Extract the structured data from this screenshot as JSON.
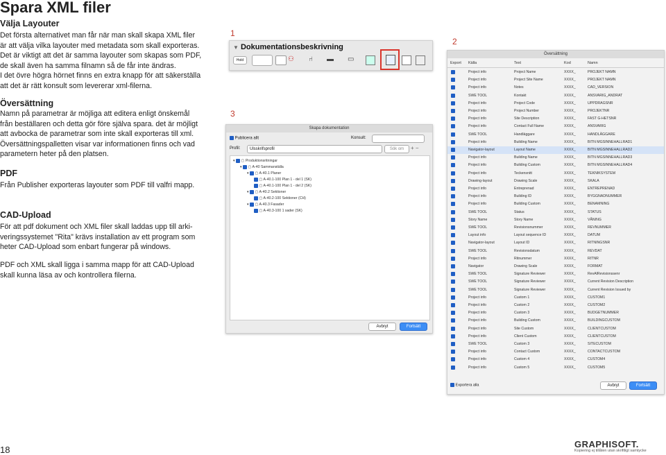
{
  "page_title": "Spara XML filer",
  "left": {
    "sec1_heading": "Välja Layouter",
    "sec1_lines": [
      "Det första alternativet man får när man skall skapa XML filer",
      "är att välja vilka layouter med metadata som skall exporteras.",
      "Det är viktigt att det är samma layouter som skapas som PDF,",
      "de skall även ha samma filnamn så de får inte ändras.",
      "I det övre högra hörnet finns en extra knapp för att säkerställa",
      "att det är rätt konsult som levererar xml-filerna."
    ],
    "sec2_heading": "Översättning",
    "sec2_lines": [
      "Namn på parametrar är möjliga att editera enligt önskemål",
      "från beställaren och detta gör före själva spara. det är möjligt",
      "att avbocka de parametrar som inte skall exporteras till xml.",
      "Översättningspalletten visar var informationen finns och vad",
      "parametern heter på den platsen."
    ],
    "sec3_heading": "PDF",
    "sec3_lines": [
      "Från Publisher exporteras layouter som PDF till valfri mapp."
    ],
    "sec4_heading": "CAD-Upload",
    "sec4_lines": [
      "För att pdf dokument och XML filer skall laddas upp till arki-",
      "veringssystemet \"Rita\" krävs installation av ett program som",
      "heter CAD-Upload som enbart fungerar på windows."
    ],
    "sec5_lines": [
      "PDF och XML skall ligga i samma mapp för att CAD-Upload",
      "skall kunna läsa av och kontrollera filerna."
    ]
  },
  "markers": {
    "one": "1",
    "two": "2",
    "three": "3"
  },
  "shot1": {
    "title": "Dokumentationsbeskrivning",
    "field_label": "Hold"
  },
  "shot3": {
    "title": "Skapa dokumentation",
    "publish_all": "Publicera allt",
    "konsult_label": "Konsult:",
    "profil_label": "Profil:",
    "profil_value": "Ulsskrifsprofil",
    "search_placeholder": "Sök om",
    "tree": [
      "Produktionsritningar",
      "A-40 Sammanställa",
      "A-40.1 Planer",
      "A-40.1-100 Plan 1 - del 1 (SK)",
      "A-40.1-100 Plan 1 - del 2 (SK)",
      "A-40.2 Sektioner",
      "A-40.2-100 Sektioner (CH)",
      "A-40.3 Fasader",
      "A-40.3-100 1 sader (SK)"
    ],
    "cancel": "Avbryt",
    "continue": "Fortsätt"
  },
  "shot2": {
    "title": "Översättning",
    "col_export": "Export",
    "col_kalla": "Källa",
    "col_text": "Text",
    "col_kod": "Kod",
    "col_namn": "Namn",
    "rows": [
      [
        "Project info",
        "Project Name",
        "XXXX_",
        "PROJEKT NAMN"
      ],
      [
        "Project info",
        "Project Site Name",
        "XXXX_",
        "PROJEKT NAMN"
      ],
      [
        "Project info",
        "Notes",
        "XXXX_",
        "CAD_VERSION"
      ],
      [
        "SWE TOOL",
        "Kontakt",
        "XXXX_",
        "ANSVARIG_ANDRAT"
      ],
      [
        "Project info",
        "Project Code",
        "XXXX_",
        "UPPDRAGSNR"
      ],
      [
        "Project info",
        "Project Number",
        "XXXX_",
        "PROJEKTNR"
      ],
      [
        "Project info",
        "Site Description",
        "XXXX_",
        "FAST G-HETSNR"
      ],
      [
        "Project info",
        "Contact Full Name",
        "XXXX_",
        "ANSVARIG"
      ],
      [
        "SWE TOOL",
        "Handläggare",
        "XXXX_",
        "HANDLÄGGARE"
      ],
      [
        "Project info",
        "Building Name",
        "XXXX_",
        "BITN MGSINNEHALLRAD1"
      ],
      [
        "Navigator-layout",
        "Layout Name",
        "XXXX_",
        "BITN MGSINNEHALLRAD2"
      ],
      [
        "Project info",
        "Building Name",
        "XXXX_",
        "BITN MGSINNEHALLRAD3"
      ],
      [
        "Project info",
        "Building Custom",
        "XXXX_",
        "BITN MGSINNEHALLRAD4"
      ],
      [
        "Project info",
        "Teckensnitt",
        "XXXX_",
        "TEKNIKSYSTEM"
      ],
      [
        "Drawing-layout",
        "Drawing Scale",
        "XXXX_",
        "SKALA"
      ],
      [
        "Project info",
        "Entreprenad",
        "XXXX_",
        "ENTREPRENAD"
      ],
      [
        "Project info",
        "Building ID",
        "XXXX_",
        "BYGGNADNUMMER"
      ],
      [
        "Project info",
        "Building Custom",
        "XXXX_",
        "BENAMNING"
      ],
      [
        "SWE TOOL",
        "Status",
        "XXXX_",
        "STATUS"
      ],
      [
        "Story Name",
        "Story Name",
        "XXXX_",
        "VÅNING"
      ],
      [
        "SWE TOOL",
        "Revisionsnummer",
        "XXXX_",
        "REVNUMMER"
      ],
      [
        "Layout info",
        "Layout sequence ID",
        "XXXX_",
        "DATUM"
      ],
      [
        "Navigator-layout",
        "Layout ID",
        "XXXX_",
        "RITNINGSNR"
      ],
      [
        "SWE TOOL",
        "Revisionsdatum",
        "XXXX_",
        "REVDAT"
      ],
      [
        "Project info",
        "Ritnummer",
        "XXXX_",
        "RITNR"
      ],
      [
        "Navigator",
        "Drawing Scale",
        "XXXX_",
        "FORMAT"
      ],
      [
        "SWE TOOL",
        "Signature Reviewer",
        "XXXX_",
        "RevAlRevisionssenr"
      ],
      [
        "SWE TOOL",
        "Signature Reviewer",
        "XXXX_",
        "Current Revision Description"
      ],
      [
        "SWE TOOL",
        "Signature Reviewer",
        "XXXX_",
        "Current Revision Issued by"
      ],
      [
        "Project info",
        "Custom 1",
        "XXXX_",
        "CUSTOM1"
      ],
      [
        "Project info",
        "Custom 2",
        "XXXX_",
        "CUSTOM2"
      ],
      [
        "Project info",
        "Custom 3",
        "XXXX_",
        "BUDGETNUMMER"
      ],
      [
        "Project info",
        "Building Custom",
        "XXXX_",
        "BUILDINGCUSTOM"
      ],
      [
        "Project info",
        "Site Custom",
        "XXXX_",
        "CLIENTCUSTOM"
      ],
      [
        "Project info",
        "Client Custom",
        "XXXX_",
        "CLIENTCUSTOM"
      ],
      [
        "SWE TOOL",
        "Custom 3",
        "XXXX_",
        "SITECUSTOM"
      ],
      [
        "Project info",
        "Contact Custom",
        "XXXX_",
        "CONTACTCUSTOM"
      ],
      [
        "Project info",
        "Custom 4",
        "XXXX_",
        "CUSTOM4"
      ],
      [
        "Project info",
        "Custom 5",
        "XXXX_",
        "CUSTOM5"
      ]
    ],
    "footer_check": "Exportera alla",
    "cancel": "Avbryt",
    "continue": "Fortsätt"
  },
  "footer": {
    "page_number": "18",
    "brand": "GRAPHISOFT.",
    "copyright": "Kopiering ej tillåten utan skriftligt samtycke"
  }
}
